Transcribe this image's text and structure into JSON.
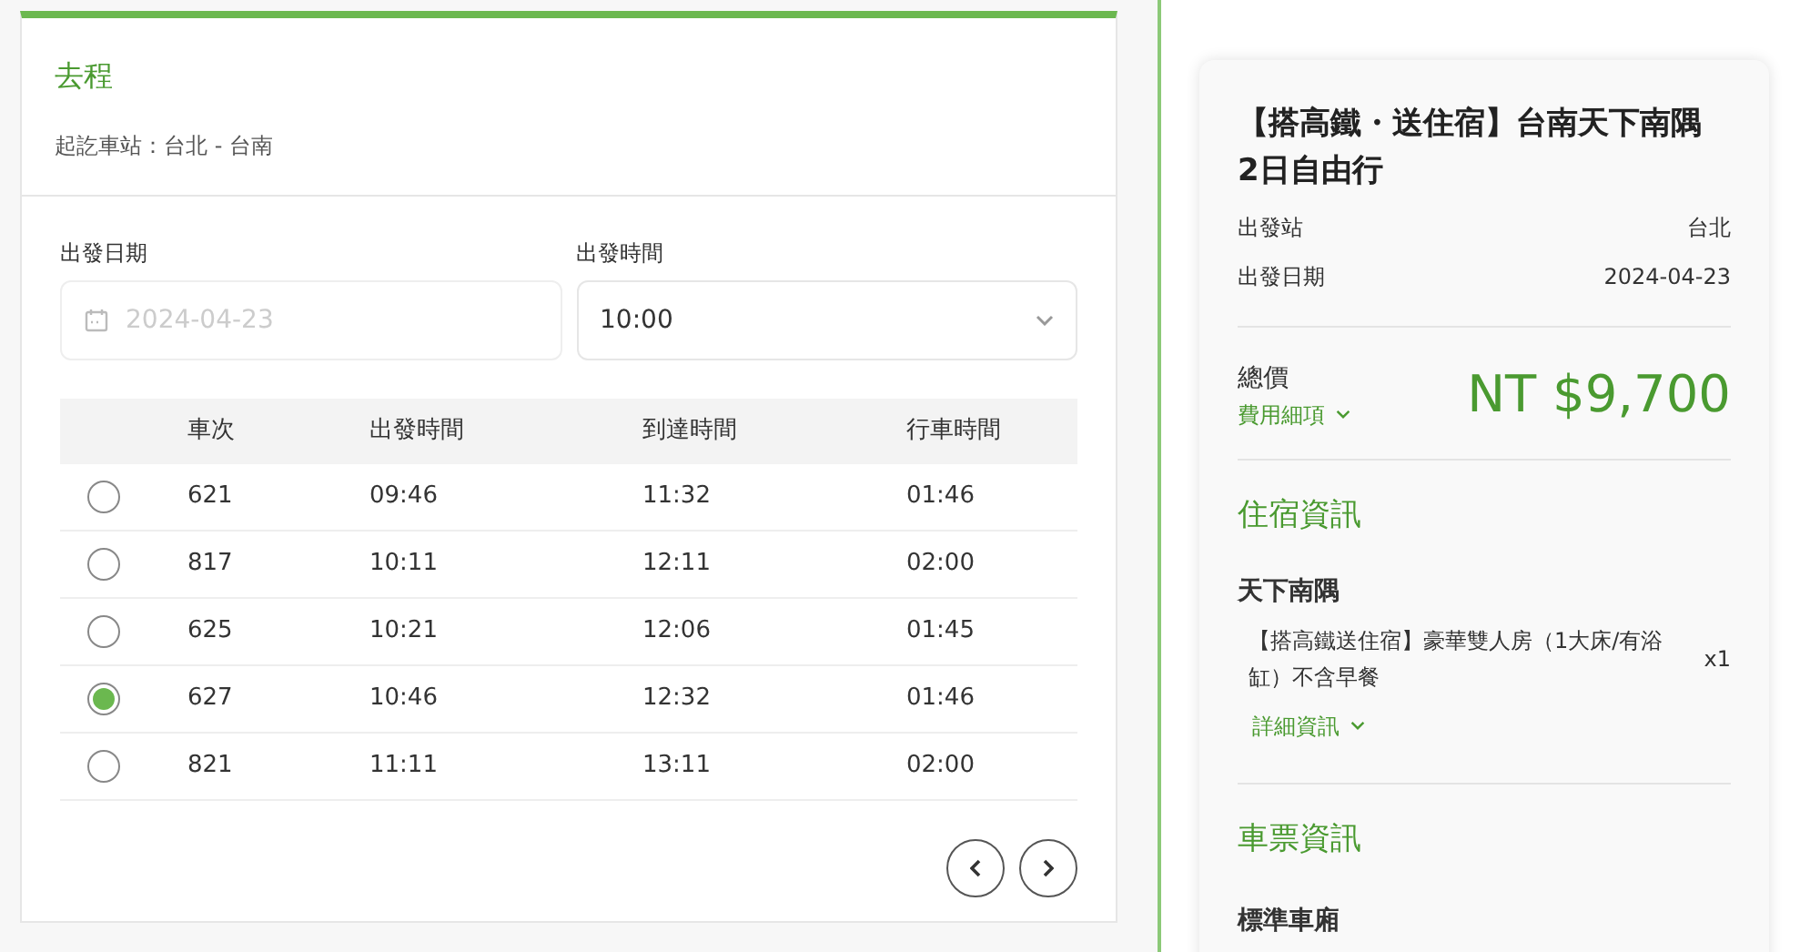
{
  "outbound": {
    "title": "去程",
    "stations": "起訖車站：台北 - 台南",
    "date_field": {
      "label": "出發日期",
      "placeholder": "2024-04-23"
    },
    "time_field": {
      "label": "出發時間",
      "value": "10:00"
    },
    "table": {
      "columns": [
        "車次",
        "出發時間",
        "到達時間",
        "行車時間"
      ],
      "rows": [
        {
          "selected": false,
          "cells": [
            "621",
            "09:46",
            "11:32",
            "01:46"
          ]
        },
        {
          "selected": false,
          "cells": [
            "817",
            "10:11",
            "12:11",
            "02:00"
          ]
        },
        {
          "selected": false,
          "cells": [
            "625",
            "10:21",
            "12:06",
            "01:45"
          ]
        },
        {
          "selected": true,
          "cells": [
            "627",
            "10:46",
            "12:32",
            "01:46"
          ]
        },
        {
          "selected": false,
          "cells": [
            "821",
            "11:11",
            "13:11",
            "02:00"
          ]
        }
      ]
    }
  },
  "summary": {
    "title": "【搭高鐵・送住宿】台南天下南隅2日自由行",
    "details": [
      {
        "label": "出發站",
        "value": "台北"
      },
      {
        "label": "出發日期",
        "value": "2024-04-23"
      }
    ],
    "total_label": "總價",
    "fee_link": "費用細項",
    "total": "NT $9,700",
    "lodging": {
      "heading": "住宿資訊",
      "hotel": "天下南隅",
      "room": "【搭高鐵送住宿】豪華雙人房（1大床/有浴缸）不含早餐",
      "quantity": "x1",
      "details_link": "詳細資訊"
    },
    "tickets": {
      "heading": "車票資訊",
      "class": "標準車廂"
    }
  }
}
